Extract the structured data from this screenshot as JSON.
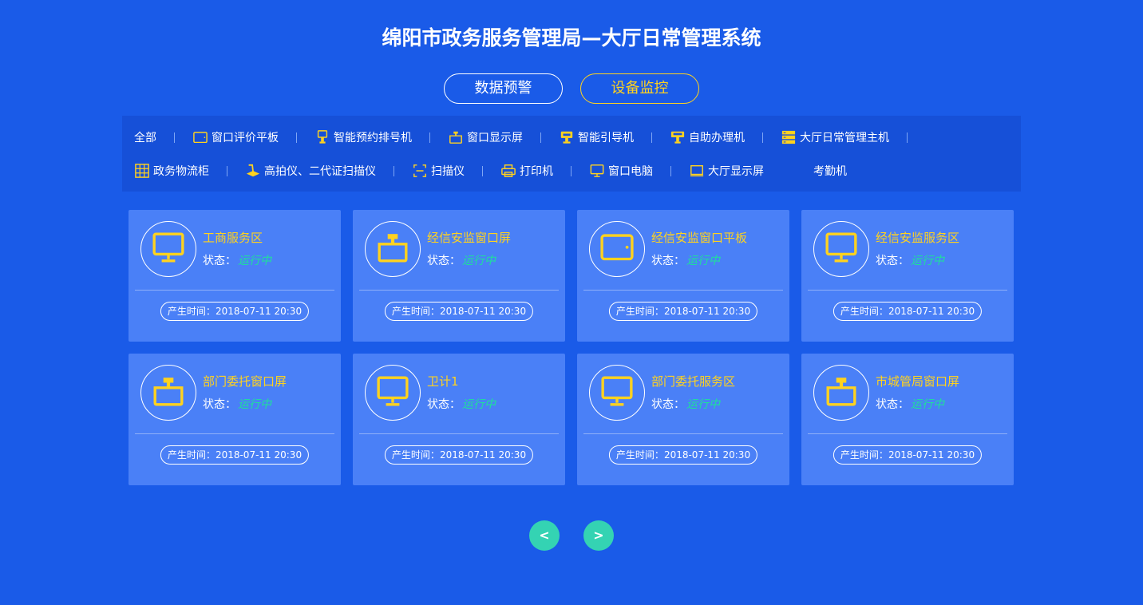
{
  "title": "绵阳市政务服务管理局—大厅日常管理系统",
  "tabs": [
    {
      "label": "数据预警",
      "active": false
    },
    {
      "label": "设备监控",
      "active": true
    }
  ],
  "filters_row1": [
    {
      "label": "全部",
      "icon": ""
    },
    {
      "label": "窗口评价平板",
      "icon": "tablet-icon"
    },
    {
      "label": "智能预约排号机",
      "icon": "queue-machine-icon"
    },
    {
      "label": "窗口显示屏",
      "icon": "window-screen-icon"
    },
    {
      "label": "智能引导机",
      "icon": "guide-machine-icon"
    },
    {
      "label": "自助办理机",
      "icon": "self-service-icon"
    },
    {
      "label": "大厅日常管理主机",
      "icon": "server-icon"
    }
  ],
  "filters_row2": [
    {
      "label": "政务物流柜",
      "icon": "locker-icon"
    },
    {
      "label": "高拍仪、二代证扫描仪",
      "icon": "document-camera-icon"
    },
    {
      "label": "扫描仪",
      "icon": "scanner-icon"
    },
    {
      "label": "打印机",
      "icon": "printer-icon"
    },
    {
      "label": "窗口电脑",
      "icon": "monitor-icon"
    },
    {
      "label": "大厅显示屏",
      "icon": "display-icon"
    },
    {
      "label": "考勤机",
      "icon": ""
    }
  ],
  "status_label": "状态：",
  "time_label": "产生时间：",
  "cards": [
    {
      "name": "工商服务区",
      "status": "运行中",
      "time": "2018-07-11 20:30",
      "icon": "monitor-icon"
    },
    {
      "name": "经信安监窗口屏",
      "status": "运行中",
      "time": "2018-07-11 20:30",
      "icon": "window-screen-icon"
    },
    {
      "name": "经信安监窗口平板",
      "status": "运行中",
      "time": "2018-07-11 20:30",
      "icon": "tablet-icon"
    },
    {
      "name": "经信安监服务区",
      "status": "运行中",
      "time": "2018-07-11 20:30",
      "icon": "monitor-icon"
    },
    {
      "name": "部门委托窗口屏",
      "status": "运行中",
      "time": "2018-07-11 20:30",
      "icon": "window-screen-icon"
    },
    {
      "name": "卫计1",
      "status": "运行中",
      "time": "2018-07-11 20:30",
      "icon": "monitor-icon"
    },
    {
      "name": "部门委托服务区",
      "status": "运行中",
      "time": "2018-07-11 20:30",
      "icon": "monitor-icon"
    },
    {
      "name": "市城管局窗口屏",
      "status": "运行中",
      "time": "2018-07-11 20:30",
      "icon": "window-screen-icon"
    }
  ],
  "pager": {
    "prev": "<",
    "next": ">"
  },
  "colors": {
    "background": "#1a5be8",
    "accent": "#ffd21f",
    "status_ok": "#1ee09b",
    "card": "#4a80f7",
    "pager": "#34d3b3"
  }
}
